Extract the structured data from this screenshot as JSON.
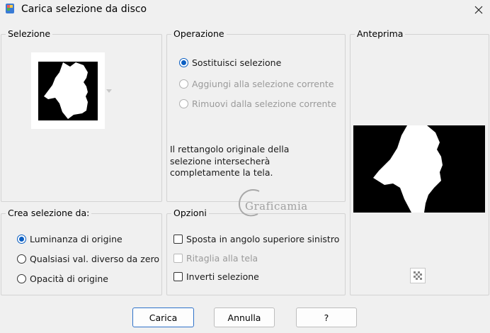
{
  "window": {
    "title": "Carica selezione da disco"
  },
  "selection_group": {
    "label": "Selezione"
  },
  "operation_group": {
    "label": "Operazione",
    "options": [
      {
        "label": "Sostituisci selezione",
        "checked": true,
        "enabled": true
      },
      {
        "label": "Aggiungi alla selezione corrente",
        "checked": false,
        "enabled": false
      },
      {
        "label": "Rimuovi dalla selezione corrente",
        "checked": false,
        "enabled": false
      }
    ],
    "info": "Il rettangolo originale della selezione intersecherà completamente la tela."
  },
  "preview_group": {
    "label": "Anteprima"
  },
  "create_group": {
    "label": "Crea selezione da:",
    "options": [
      {
        "label": "Luminanza di origine",
        "checked": true
      },
      {
        "label": "Qualsiasi val. diverso da zero",
        "checked": false
      },
      {
        "label": "Opacità di origine",
        "checked": false
      }
    ]
  },
  "options_group": {
    "label": "Opzioni",
    "items": [
      {
        "label": "Sposta in angolo superiore sinistro",
        "checked": false,
        "enabled": true
      },
      {
        "label": "Ritaglia alla tela",
        "checked": false,
        "enabled": false
      },
      {
        "label": "Inverti selezione",
        "checked": false,
        "enabled": true
      }
    ]
  },
  "watermark": {
    "text": "Graficamia"
  },
  "buttons": {
    "load": "Carica",
    "cancel": "Annulla",
    "help": "?"
  },
  "colors": {
    "accent": "#0a5ec2",
    "background": "#f0f0f0"
  }
}
